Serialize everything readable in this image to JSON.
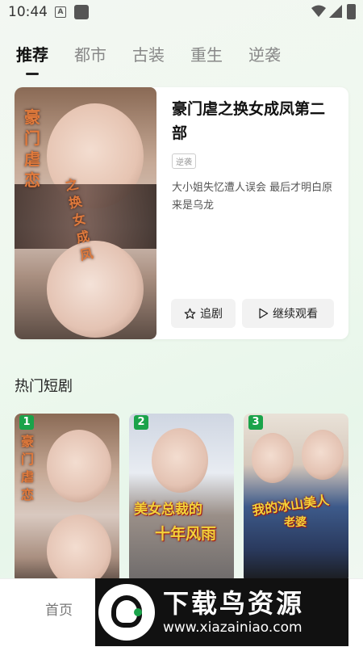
{
  "status_bar": {
    "time": "10:44",
    "notif_letter": "A"
  },
  "tabs": [
    {
      "label": "推荐",
      "active": true
    },
    {
      "label": "都市",
      "active": false
    },
    {
      "label": "古装",
      "active": false
    },
    {
      "label": "重生",
      "active": false
    },
    {
      "label": "逆袭",
      "active": false
    }
  ],
  "featured": {
    "poster_text_1": "豪门虐恋",
    "poster_text_2": "之换女成凤",
    "title": "豪门虐之换女成凤第二部",
    "tag": "逆袭",
    "description": "大小姐失忆遭人误会 最后才明白原来是乌龙",
    "follow_label": "追剧",
    "continue_label": "继续观看"
  },
  "hot_section": {
    "title": "热门短剧",
    "items": [
      {
        "rank": "1",
        "caption": "豪门虐恋"
      },
      {
        "rank": "2",
        "caption_line1": "美女总裁的",
        "caption_line2": "十年风雨"
      },
      {
        "rank": "3",
        "caption_line1": "我的冰山美人",
        "caption_line2": "老婆"
      }
    ]
  },
  "bottom_nav": {
    "home_label": "首页"
  },
  "watermark": {
    "name": "下载鸟资源",
    "url": "www.xiazainiao.com"
  },
  "colors": {
    "accent_green": "#1aa34a",
    "title_text": "#111111"
  },
  "icons": [
    "wifi-icon",
    "signal-icon",
    "battery-icon",
    "star-icon",
    "play-icon"
  ]
}
